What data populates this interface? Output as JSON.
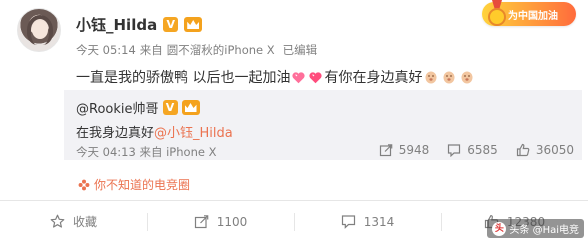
{
  "author": {
    "username": "小钰_Hilda",
    "verified_badge": "V",
    "member_badge": "crown-icon"
  },
  "meta": {
    "time": "今天 05:14",
    "source_prefix": "来自",
    "source": "圆不溜秋的iPhone X",
    "edited": "已编辑"
  },
  "promo": {
    "text": "为中国加油"
  },
  "post": {
    "text_part1": "一直是我的骄傲鸭 以后也一起加油",
    "text_part2": "有你在身边真好",
    "emojis": [
      "heart-icon",
      "heart-icon",
      "face-icon",
      "face-icon",
      "face-icon"
    ]
  },
  "repost": {
    "author": "@Rookie帅哥",
    "verified_badge": "V",
    "text": "在我身边真好",
    "mention": "@小钰_Hilda",
    "time": "今天 04:13",
    "source_prefix": "来自",
    "source": "iPhone X",
    "stats": {
      "reposts": "5948",
      "comments": "6585",
      "likes": "36050"
    }
  },
  "topic": {
    "label": "你不知道的电竞圈"
  },
  "actions": {
    "favorite": "收藏",
    "repost": "1100",
    "comment": "1314",
    "like": "12380"
  },
  "watermark": {
    "text": "头条 @Hai电竞"
  },
  "colors": {
    "link_orange": "#eb7350",
    "meta_gray": "#808080",
    "repost_bg": "#f2f2f5",
    "badge_gold": "#f5a623"
  }
}
